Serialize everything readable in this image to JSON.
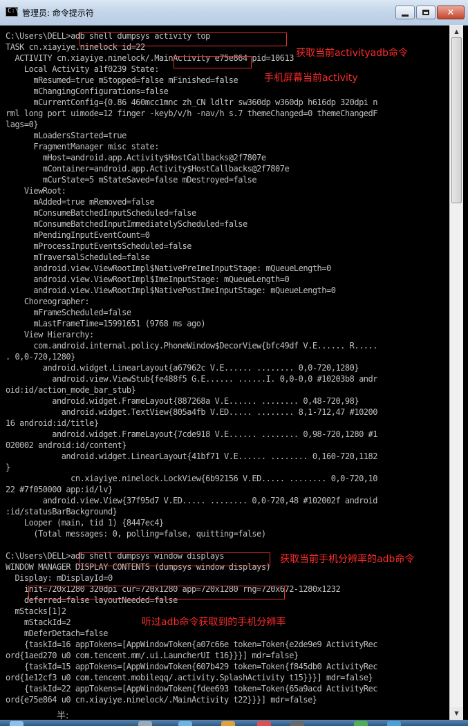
{
  "window": {
    "title": "管理员: 命令提示符",
    "app_icon_label": "C:\\"
  },
  "lines": [
    {
      "text": "C:\\Users\\DELL>adb shell dumpsys activity top",
      "indent": 0
    },
    {
      "text": "TASK cn.xiayiye.ninelock id=22",
      "indent": 0
    },
    {
      "text": "  ACTIVITY cn.xiayiye.ninelock/.MainActivity e75e864 pid=10613",
      "indent": 0
    },
    {
      "text": "    Local Activity a1f0239 State:",
      "indent": 0
    },
    {
      "text": "      mResumed=true mStopped=false mFinished=false",
      "indent": 0
    },
    {
      "text": "      mChangingConfigurations=false",
      "indent": 0
    },
    {
      "text": "      mCurrentConfig={0.86 460mcc1mnc zh_CN ldltr sw360dp w360dp h616dp 320dpi n",
      "indent": 0
    },
    {
      "text": "rml long port uimode=12 finger -keyb/v/h -nav/h s.7 themeChanged=0 themeChangedF",
      "indent": 0
    },
    {
      "text": "lags=0}",
      "indent": 0
    },
    {
      "text": "      mLoadersStarted=true",
      "indent": 0
    },
    {
      "text": "      FragmentManager misc state:",
      "indent": 0
    },
    {
      "text": "        mHost=android.app.Activity$HostCallbacks@2f7807e",
      "indent": 0
    },
    {
      "text": "        mContainer=android.app.Activity$HostCallbacks@2f7807e",
      "indent": 0
    },
    {
      "text": "        mCurState=5 mStateSaved=false mDestroyed=false",
      "indent": 0
    },
    {
      "text": "    ViewRoot:",
      "indent": 0
    },
    {
      "text": "      mAdded=true mRemoved=false",
      "indent": 0
    },
    {
      "text": "      mConsumeBatchedInputScheduled=false",
      "indent": 0
    },
    {
      "text": "      mConsumeBatchedInputImmediatelyScheduled=false",
      "indent": 0
    },
    {
      "text": "      mPendingInputEventCount=0",
      "indent": 0
    },
    {
      "text": "      mProcessInputEventsScheduled=false",
      "indent": 0
    },
    {
      "text": "      mTraversalScheduled=false",
      "indent": 0
    },
    {
      "text": "      android.view.ViewRootImpl$NativePreImeInputStage: mQueueLength=0",
      "indent": 0
    },
    {
      "text": "      android.view.ViewRootImpl$ImeInputStage: mQueueLength=0",
      "indent": 0
    },
    {
      "text": "      android.view.ViewRootImpl$NativePostImeInputStage: mQueueLength=0",
      "indent": 0
    },
    {
      "text": "    Choreographer:",
      "indent": 0
    },
    {
      "text": "      mFrameScheduled=false",
      "indent": 0
    },
    {
      "text": "      mLastFrameTime=15991651 (9768 ms ago)",
      "indent": 0
    },
    {
      "text": "    View Hierarchy:",
      "indent": 0
    },
    {
      "text": "      com.android.internal.policy.PhoneWindow$DecorView{bfc49df V.E...... R.....",
      "indent": 0
    },
    {
      "text": ". 0,0-720,1280}",
      "indent": 0
    },
    {
      "text": "        android.widget.LinearLayout{a67962c V.E...... ........ 0,0-720,1280}",
      "indent": 0
    },
    {
      "text": "          android.view.ViewStub{fe488f5 G.E...... ......I. 0,0-0,0 #10203b8 andr",
      "indent": 0
    },
    {
      "text": "oid:id/action_mode_bar_stub}",
      "indent": 0
    },
    {
      "text": "          android.widget.FrameLayout{887268a V.E...... ........ 0,48-720,98}",
      "indent": 0
    },
    {
      "text": "            android.widget.TextView{805a4fb V.ED..... ........ 8,1-712,47 #10200",
      "indent": 0
    },
    {
      "text": "16 android:id/title}",
      "indent": 0
    },
    {
      "text": "          android.widget.FrameLayout{7cde918 V.E...... ........ 0,98-720,1280 #1",
      "indent": 0
    },
    {
      "text": "020002 android:id/content}",
      "indent": 0
    },
    {
      "text": "            android.widget.LinearLayout{41bf71 V.E...... ........ 0,160-720,1182",
      "indent": 0
    },
    {
      "text": "}",
      "indent": 0
    },
    {
      "text": "              cn.xiayiye.ninelock.LockView{6b92156 V.ED..... ........ 0,0-720,10",
      "indent": 0
    },
    {
      "text": "22 #7f050000 app:id/lv}",
      "indent": 0
    },
    {
      "text": "        android.view.View{37f95d7 V.ED..... ........ 0,0-720,48 #102002f android",
      "indent": 0
    },
    {
      "text": ":id/statusBarBackground}",
      "indent": 0
    },
    {
      "text": "    Looper (main, tid 1) {8447ec4}",
      "indent": 0
    },
    {
      "text": "      (Total messages: 0, polling=false, quitting=false)",
      "indent": 0
    },
    {
      "text": "",
      "indent": 0
    },
    {
      "text": "C:\\Users\\DELL>adb shell dumpsys window displays",
      "indent": 0
    },
    {
      "text": "WINDOW MANAGER DISPLAY CONTENTS (dumpsys window displays)",
      "indent": 0
    },
    {
      "text": "  Display: mDisplayId=0",
      "indent": 0
    },
    {
      "text": "    init=720x1280 320dpi cur=720x1280 app=720x1280 rng=720x672-1280x1232",
      "indent": 0
    },
    {
      "text": "    deferred=false layoutNeeded=false",
      "indent": 0
    },
    {
      "text": "  mStacks[1]2",
      "indent": 0
    },
    {
      "text": "    mStackId=2",
      "indent": 0
    },
    {
      "text": "    mDeferDetach=false",
      "indent": 0
    },
    {
      "text": "    {taskId=16 appTokens=[AppWindowToken{a07c66e token=Token{e2de9e9 ActivityRec",
      "indent": 0
    },
    {
      "text": "ord{1aed270 u0 com.tencent.mm/.ui.LauncherUI t16}}}] mdr=false}",
      "indent": 0
    },
    {
      "text": "    {taskId=15 appTokens=[AppWindowToken{607b429 token=Token{f845db0 ActivityRec",
      "indent": 0
    },
    {
      "text": "ord{1e12cf3 u0 com.tencent.mobileqq/.activity.SplashActivity t15}}}] mdr=false}",
      "indent": 0
    },
    {
      "text": "    {taskId=22 appTokens=[AppWindowToken{fdee693 token=Token{65a9acd ActivityRec",
      "indent": 0
    },
    {
      "text": "ord{e75e864 u0 cn.xiayiye.ninelock/.MainActivity t22}}}] mdr=false}",
      "indent": 0
    }
  ],
  "annotations": {
    "note1": "获取当前activityadb命令",
    "note2": "手机屏幕当前activity",
    "note3": "获取当前手机分辨率的adb命令",
    "note4": "听过adb命令获取到的手机分辨率"
  },
  "ime_text": "半:",
  "colors": {
    "console_bg": "#000000",
    "console_text": "#c0c0c0",
    "annotation": "#ff2a2a"
  }
}
